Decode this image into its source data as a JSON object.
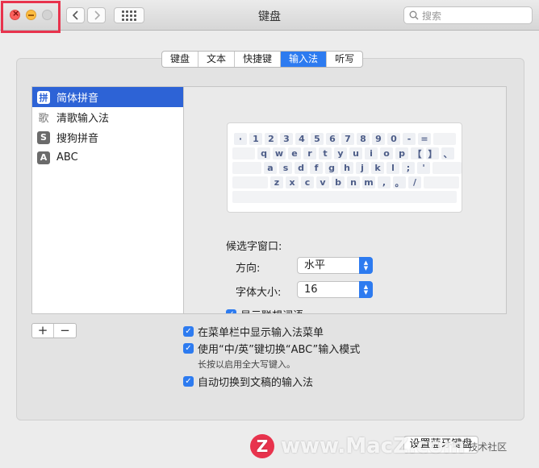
{
  "window": {
    "title": "键盘"
  },
  "search": {
    "placeholder": "搜索"
  },
  "tabs": [
    {
      "label": "键盘",
      "active": false
    },
    {
      "label": "文本",
      "active": false
    },
    {
      "label": "快捷键",
      "active": false
    },
    {
      "label": "输入法",
      "active": true
    },
    {
      "label": "听写",
      "active": false
    }
  ],
  "input_sources": [
    {
      "label": "简体拼音",
      "icon": "拼",
      "selected": true
    },
    {
      "label": "清歌输入法",
      "icon": "歌",
      "selected": false
    },
    {
      "label": "搜狗拼音",
      "icon": "S",
      "selected": false
    },
    {
      "label": "ABC",
      "icon": "A",
      "selected": false
    }
  ],
  "keyboard": {
    "row1": [
      "·",
      "1",
      "2",
      "3",
      "4",
      "5",
      "6",
      "7",
      "8",
      "9",
      "0",
      "-",
      "="
    ],
    "row2": [
      "q",
      "w",
      "e",
      "r",
      "t",
      "y",
      "u",
      "i",
      "o",
      "p",
      "【",
      "】",
      "、"
    ],
    "row3": [
      "a",
      "s",
      "d",
      "f",
      "g",
      "h",
      "j",
      "k",
      "l",
      ";",
      "'"
    ],
    "row4": [
      "z",
      "x",
      "c",
      "v",
      "b",
      "n",
      "m",
      ",",
      "。",
      "/"
    ]
  },
  "candidate": {
    "section_label": "候选字窗口:",
    "direction_label": "方向:",
    "direction_value": "水平",
    "font_size_label": "字体大小:",
    "font_size_value": "16",
    "show_association_label": "显示联想词语"
  },
  "options": {
    "show_menu_label": "在菜单栏中显示输入法菜单",
    "switch_mode_label": "使用“中/英”键切换“ABC”输入模式",
    "switch_mode_note": "长按以启用全大写键入。",
    "auto_switch_label": "自动切换到文稿的输入法"
  },
  "list_controls": {
    "add": "+",
    "remove": "−"
  },
  "bottom": {
    "setup_button": "设置蓝牙键盘"
  },
  "watermark": {
    "logo": "Z",
    "text": "www.MacZ.com",
    "sub": "技术社区"
  },
  "colors": {
    "accent": "#2d7bf0",
    "selection": "#2d63d6",
    "highlight_frame": "#e8334d"
  }
}
